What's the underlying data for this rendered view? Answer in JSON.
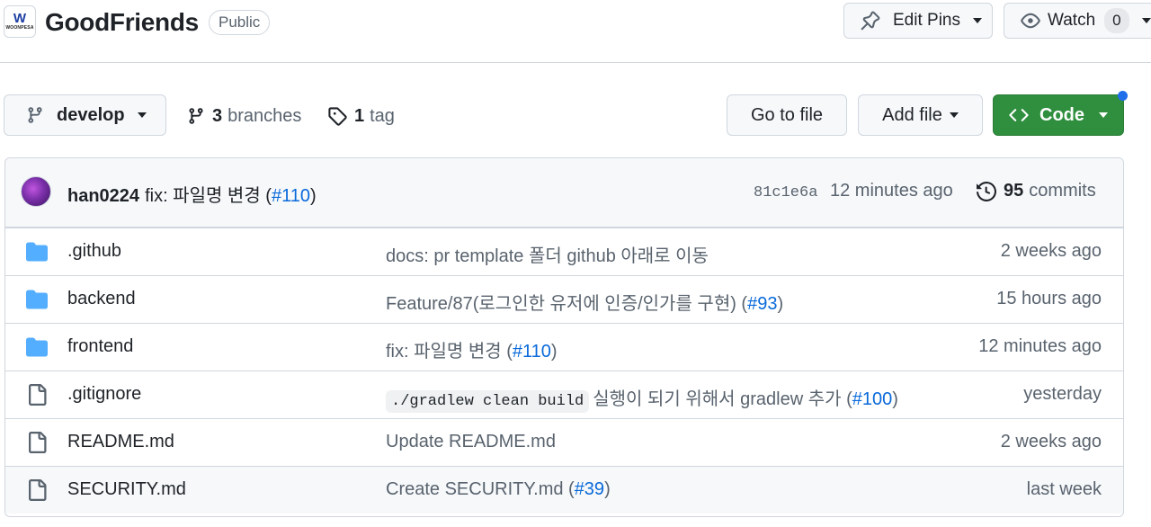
{
  "header": {
    "logo_letter": "W",
    "logo_text": "WOONPESA",
    "repo_name": "GoodFriends",
    "visibility": "Public",
    "edit_pins_label": "Edit Pins",
    "watch_label": "Watch",
    "watch_count": "0"
  },
  "toolbar": {
    "branch": "develop",
    "branches_count": "3",
    "branches_label": "branches",
    "tags_count": "1",
    "tags_label": "tag",
    "goto_file_label": "Go to file",
    "add_file_label": "Add file",
    "code_label": "Code"
  },
  "latest_commit": {
    "author": "han0224",
    "message_prefix": "fix: 파일명 변경 (",
    "pr": "#110",
    "message_suffix": ")",
    "sha": "81c1e6a",
    "time": "12 minutes ago",
    "commits_count": "95",
    "commits_label": "commits"
  },
  "files": [
    {
      "name": ".github",
      "type": "folder",
      "msg_prefix": "docs: pr template 폴더 github 아래로 이동",
      "pr": "",
      "msg_suffix": "",
      "age": "2 weeks ago"
    },
    {
      "name": "backend",
      "type": "folder",
      "msg_prefix": "Feature/87(로그인한 유저에 인증/인가를 구현) (",
      "pr": "#93",
      "msg_suffix": ")",
      "age": "15 hours ago"
    },
    {
      "name": "frontend",
      "type": "folder",
      "msg_prefix": "fix: 파일명 변경 (",
      "pr": "#110",
      "msg_suffix": ")",
      "age": "12 minutes ago"
    },
    {
      "name": ".gitignore",
      "type": "file",
      "code": "./gradlew clean build",
      "msg_prefix": "실행이 되기 위해서 gradlew 추가 (",
      "pr": "#100",
      "msg_suffix": ")",
      "age": "yesterday"
    },
    {
      "name": "README.md",
      "type": "file",
      "msg_prefix": "Update README.md",
      "pr": "",
      "msg_suffix": "",
      "age": "2 weeks ago"
    },
    {
      "name": "SECURITY.md",
      "type": "file",
      "msg_prefix": "Create SECURITY.md (",
      "pr": "#39",
      "msg_suffix": ")",
      "age": "last week"
    }
  ],
  "colors": {
    "accent_link": "#0969da",
    "code_button": "#2f8f3e",
    "folder_icon": "#54aeff",
    "notification_dot": "#1f6feb"
  }
}
